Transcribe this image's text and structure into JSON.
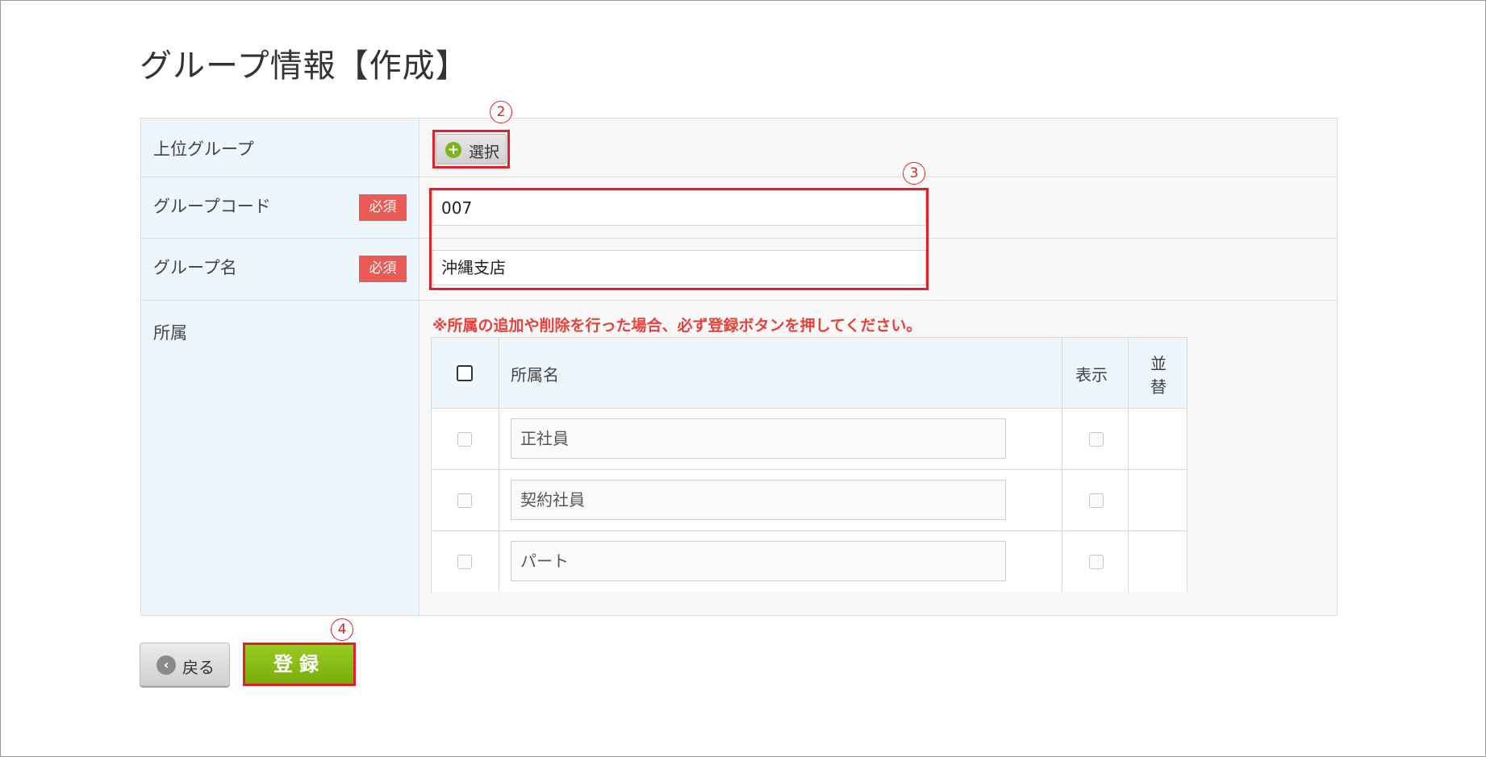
{
  "page": {
    "title": "グループ情報【作成】"
  },
  "form": {
    "parent_group": {
      "label": "上位グループ",
      "button_label": "選択",
      "marker": "2"
    },
    "group_code": {
      "label": "グループコード",
      "required": "必須",
      "value": "007"
    },
    "group_name": {
      "label": "グループ名",
      "required": "必須",
      "value": "沖縄支店"
    },
    "fields_marker": "3",
    "affiliation": {
      "label": "所属",
      "notice": "※所属の追加や削除を行った場合、必ず登録ボタンを押してください。",
      "columns": {
        "name": "所属名",
        "display": "表示",
        "sort_line1": "並",
        "sort_line2": "替"
      },
      "rows": [
        {
          "name": "正社員"
        },
        {
          "name": "契約社員"
        },
        {
          "name": "パート"
        }
      ]
    }
  },
  "actions": {
    "back_label": "戻る",
    "submit_label": "登録",
    "submit_marker": "4"
  }
}
